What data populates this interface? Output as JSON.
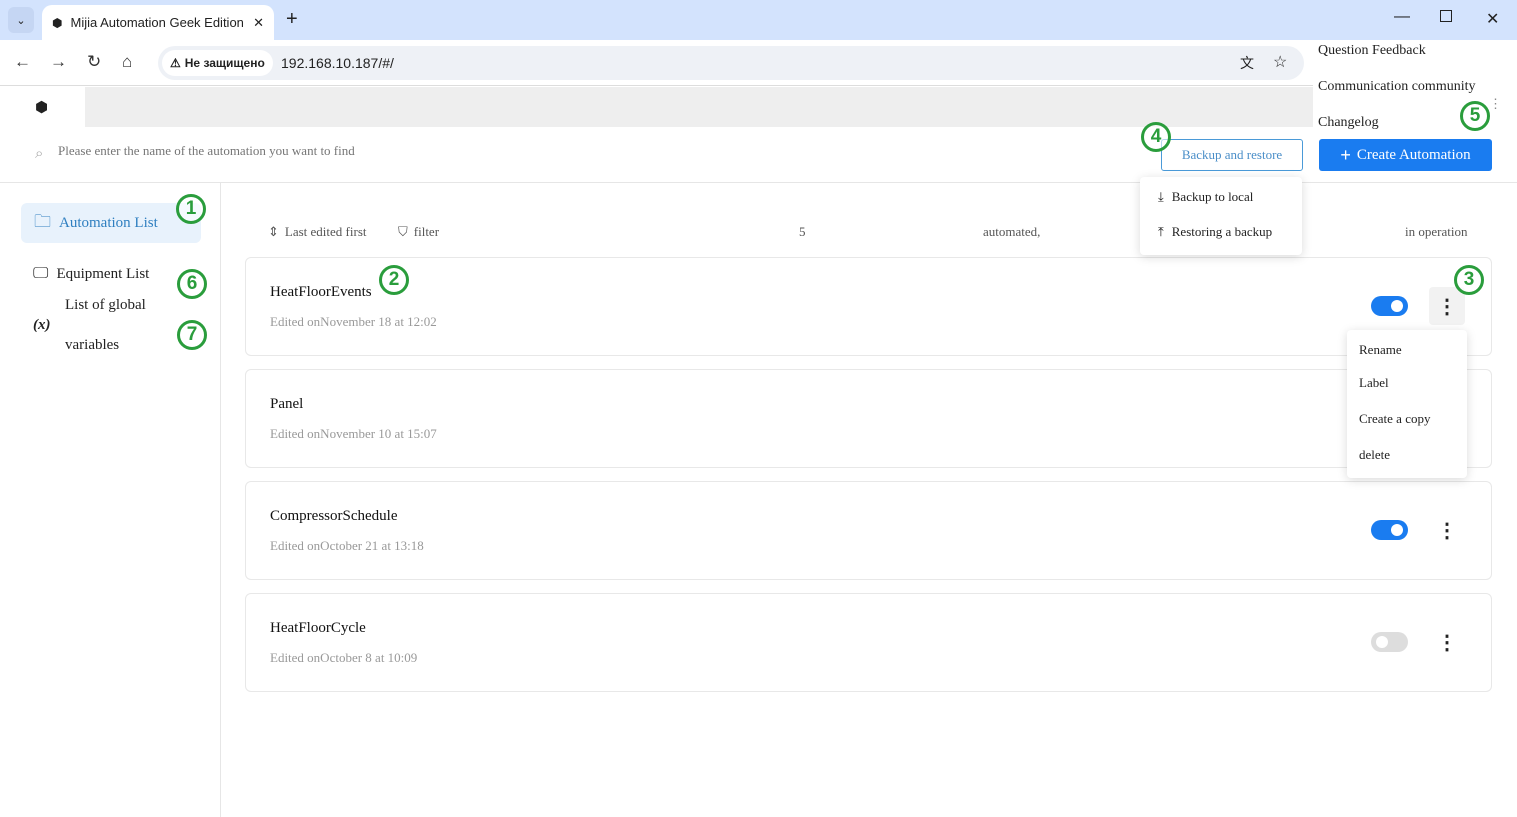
{
  "browser": {
    "tab_title": "Mijia Automation Geek Edition",
    "security_label": "Не защищено",
    "url": "192.168.10.187/#/"
  },
  "header_menu": {
    "items": [
      "Question Feedback",
      "Communication community",
      "Changelog"
    ]
  },
  "search": {
    "placeholder": "Please enter the name of the automation you want to find"
  },
  "toolbar": {
    "backup_label": "Backup and restore",
    "create_label": "Create Automation",
    "backup_menu": [
      "Backup to local",
      "Restoring a backup"
    ]
  },
  "sidebar": {
    "items": [
      {
        "label": "Automation List",
        "active": true
      },
      {
        "label": "Equipment List"
      },
      {
        "label": "List of global variables",
        "label_line1": "List of global",
        "label_line2": "variables",
        "icon_text": "(x)"
      }
    ]
  },
  "list_header": {
    "sort_label": "Last edited first",
    "filter_label": "filter",
    "count": "5",
    "count_label": "automated,",
    "status_label": "in operation"
  },
  "automations": [
    {
      "name": "HeatFloorEvents",
      "edited": "Edited onNovember 18 at 12:02",
      "enabled": true
    },
    {
      "name": "Panel",
      "edited": "Edited onNovember 10 at 15:07"
    },
    {
      "name": "CompressorSchedule",
      "edited": "Edited onOctober 21 at 13:18",
      "enabled": true
    },
    {
      "name": "HeatFloorCycle",
      "edited": "Edited onOctober 8 at 10:09",
      "enabled": false
    }
  ],
  "context_menu": {
    "items": [
      "Rename",
      "Label",
      "Create a copy",
      "delete"
    ]
  },
  "annotations": [
    "1",
    "2",
    "3",
    "4",
    "5",
    "6",
    "7"
  ],
  "colors": {
    "accent": "#1a7cf0",
    "annotation": "#2a9d3c",
    "active_bg": "#e8f2fc"
  }
}
